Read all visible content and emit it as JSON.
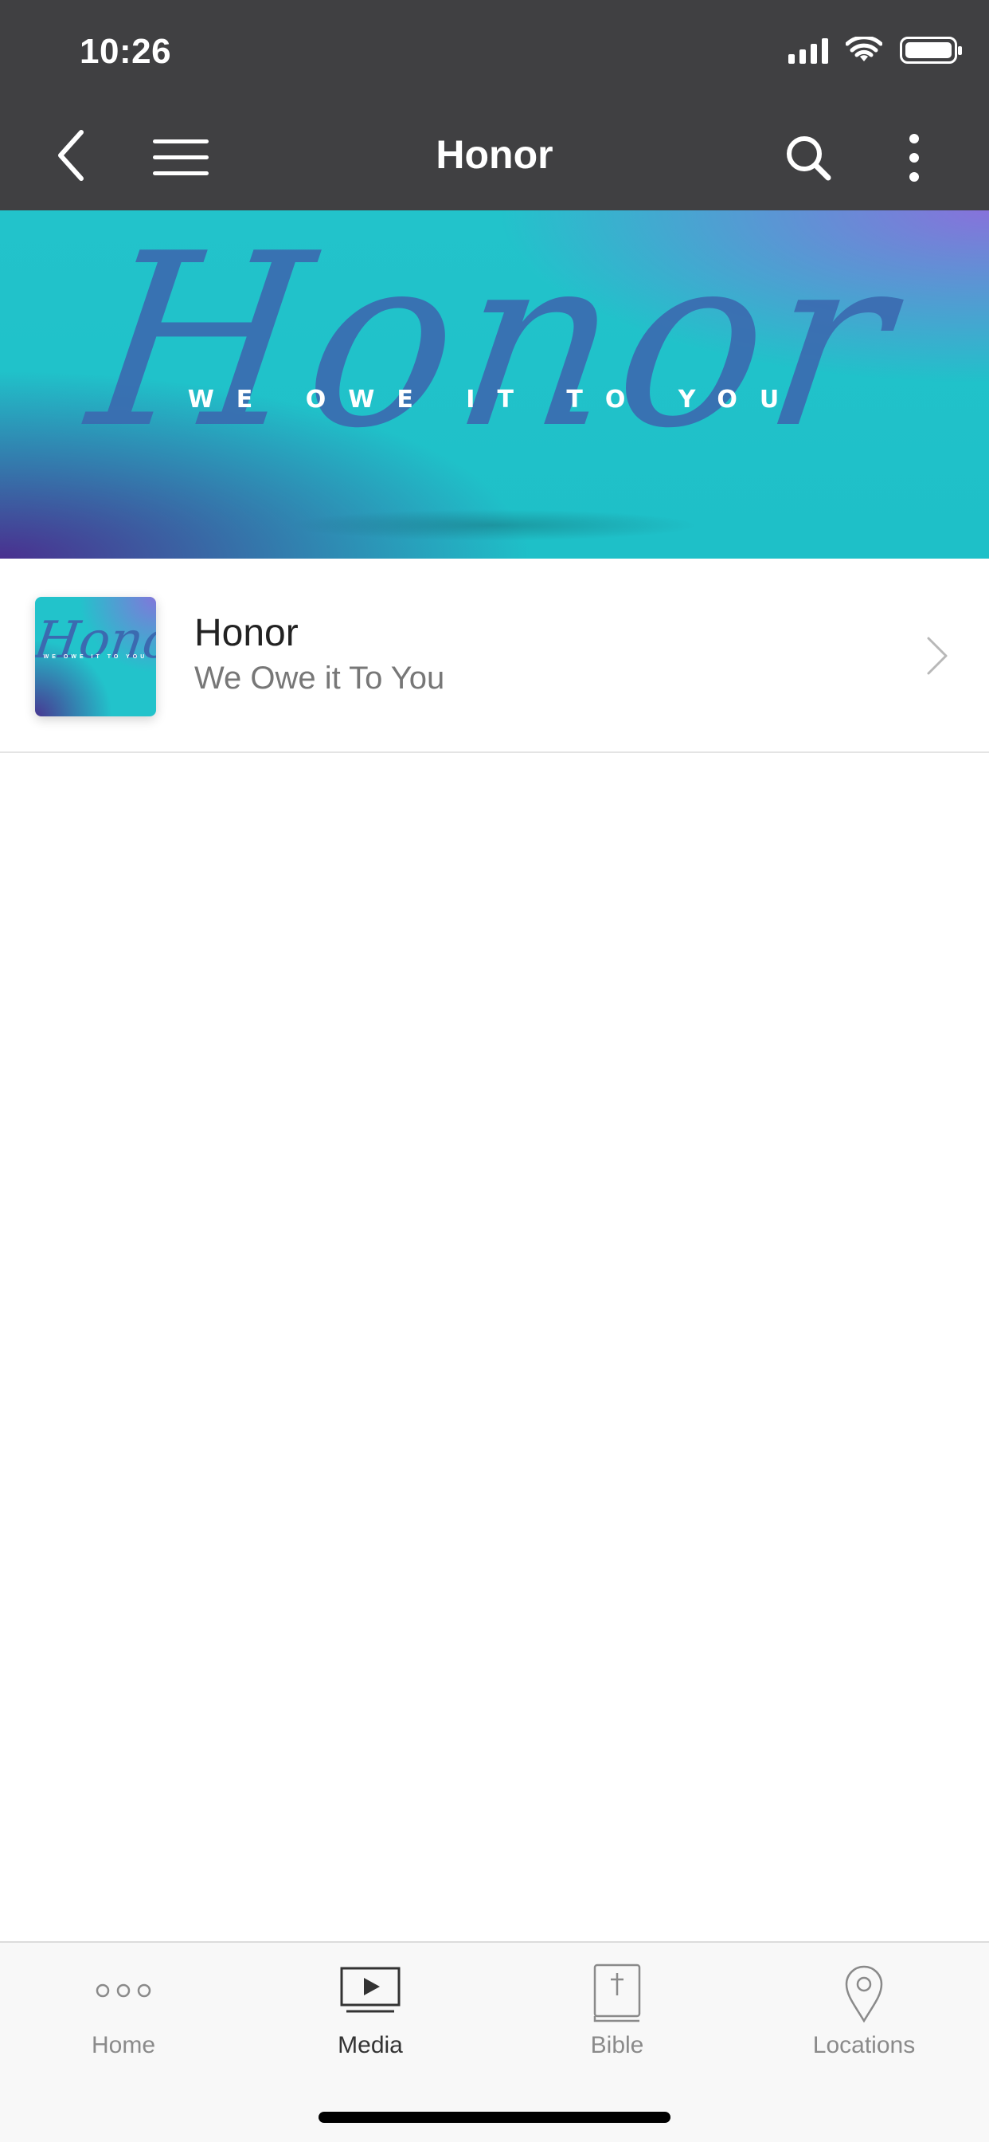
{
  "status_bar": {
    "time": "10:26"
  },
  "nav": {
    "title": "Honor"
  },
  "banner": {
    "script_title": "Honor",
    "subtitle": "WE OWE IT TO YOU"
  },
  "list": {
    "items": [
      {
        "title": "Honor",
        "subtitle": "We Owe it To You",
        "thumb_script": "Honor",
        "thumb_sub": "WE OWE IT TO YOU"
      }
    ]
  },
  "tabs": [
    {
      "label": "Home",
      "icon": "ellipsis-icon",
      "active": false
    },
    {
      "label": "Media",
      "icon": "media-player-icon",
      "active": true
    },
    {
      "label": "Bible",
      "icon": "bible-icon",
      "active": false
    },
    {
      "label": "Locations",
      "icon": "location-pin-icon",
      "active": false
    }
  ],
  "colors": {
    "header_bg": "#404042",
    "banner_teal": "#22c3cb",
    "banner_purple": "#4c288c",
    "script_blue": "#3b6ab0"
  }
}
